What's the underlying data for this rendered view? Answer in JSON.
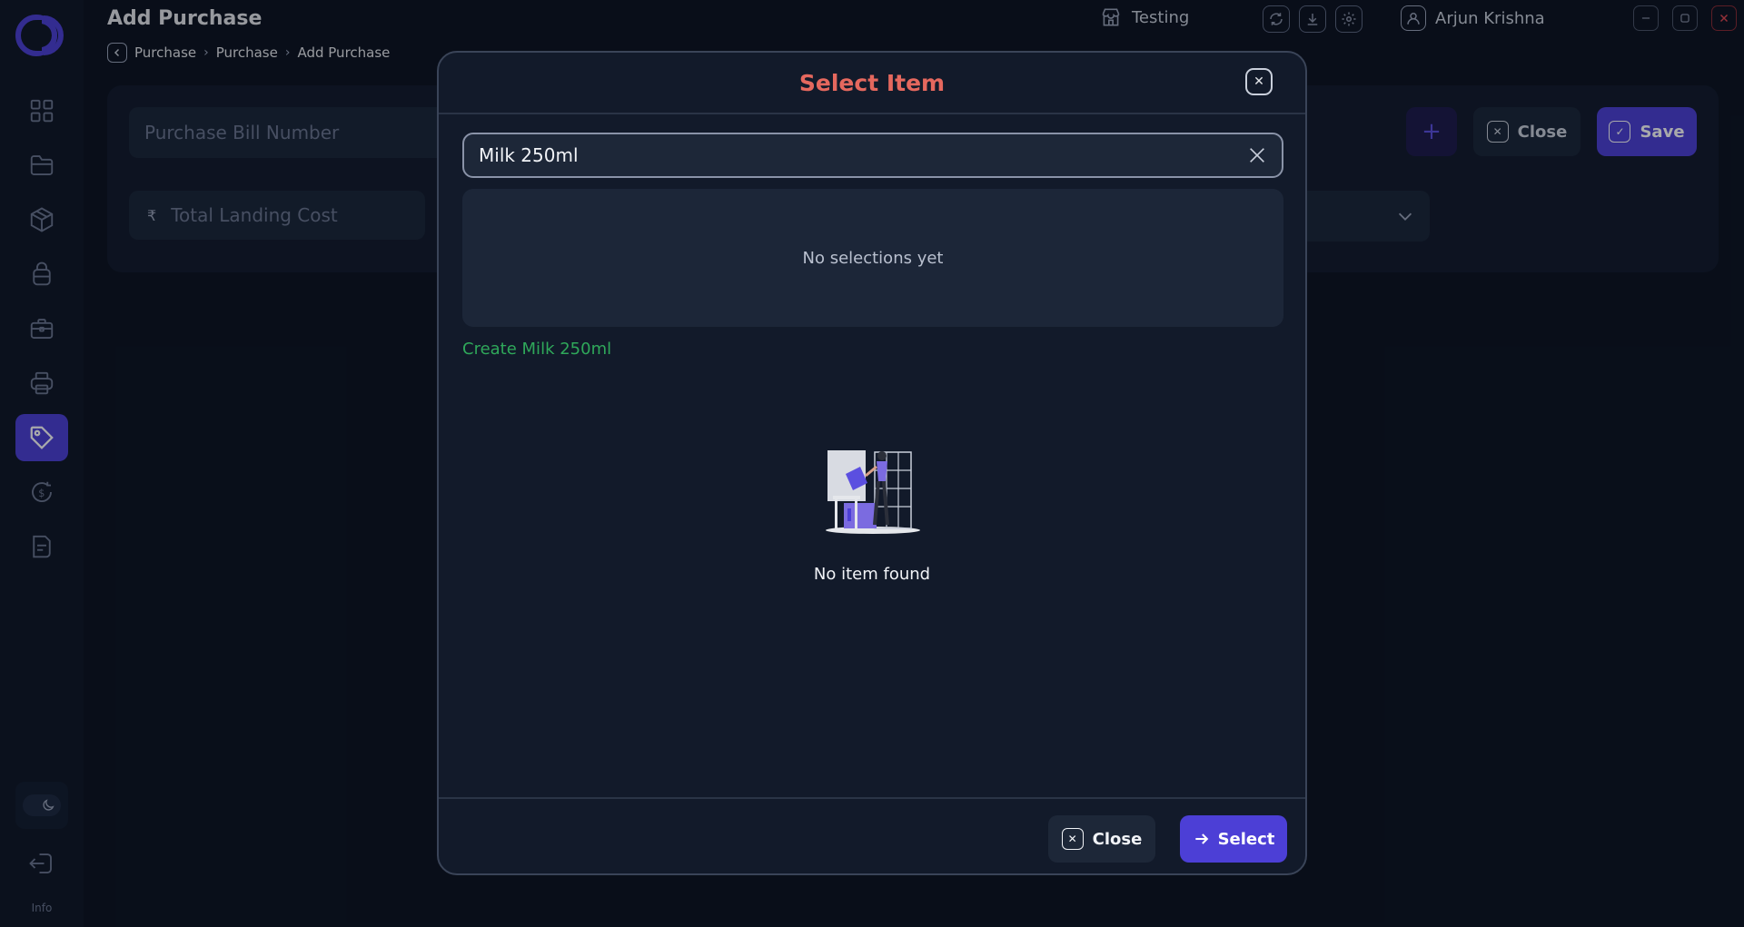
{
  "header": {
    "title": "Add Purchase",
    "breadcrumb": [
      "Purchase",
      "Purchase",
      "Add Purchase"
    ],
    "store": "Testing",
    "user": "Arjun Krishna"
  },
  "sidebar": {
    "items": [
      {
        "icon": "dashboard-icon"
      },
      {
        "icon": "folder-icon"
      },
      {
        "icon": "box-icon"
      },
      {
        "icon": "bag-icon"
      },
      {
        "icon": "briefcase-icon"
      },
      {
        "icon": "printer-icon"
      },
      {
        "icon": "tag-icon",
        "active": true
      },
      {
        "icon": "dollar-refresh-icon"
      },
      {
        "icon": "document-icon"
      }
    ],
    "info_label": "Info"
  },
  "form": {
    "bill_placeholder": "Purchase Bill Number",
    "currency_symbol": "₹",
    "landing_placeholder": "Total Landing Cost",
    "close_label": "Close",
    "save_label": "Save"
  },
  "modal": {
    "title": "Select Item",
    "search_value": "Milk 250ml",
    "selection_text": "No selections yet",
    "create_link": "Create Milk 250ml",
    "empty_text": "No item found",
    "close_label": "Close",
    "select_label": "Select"
  },
  "colors": {
    "accent": "#4c3fd6",
    "title": "#e5685e",
    "create": "#2fa85a",
    "background": "#0b1220"
  }
}
